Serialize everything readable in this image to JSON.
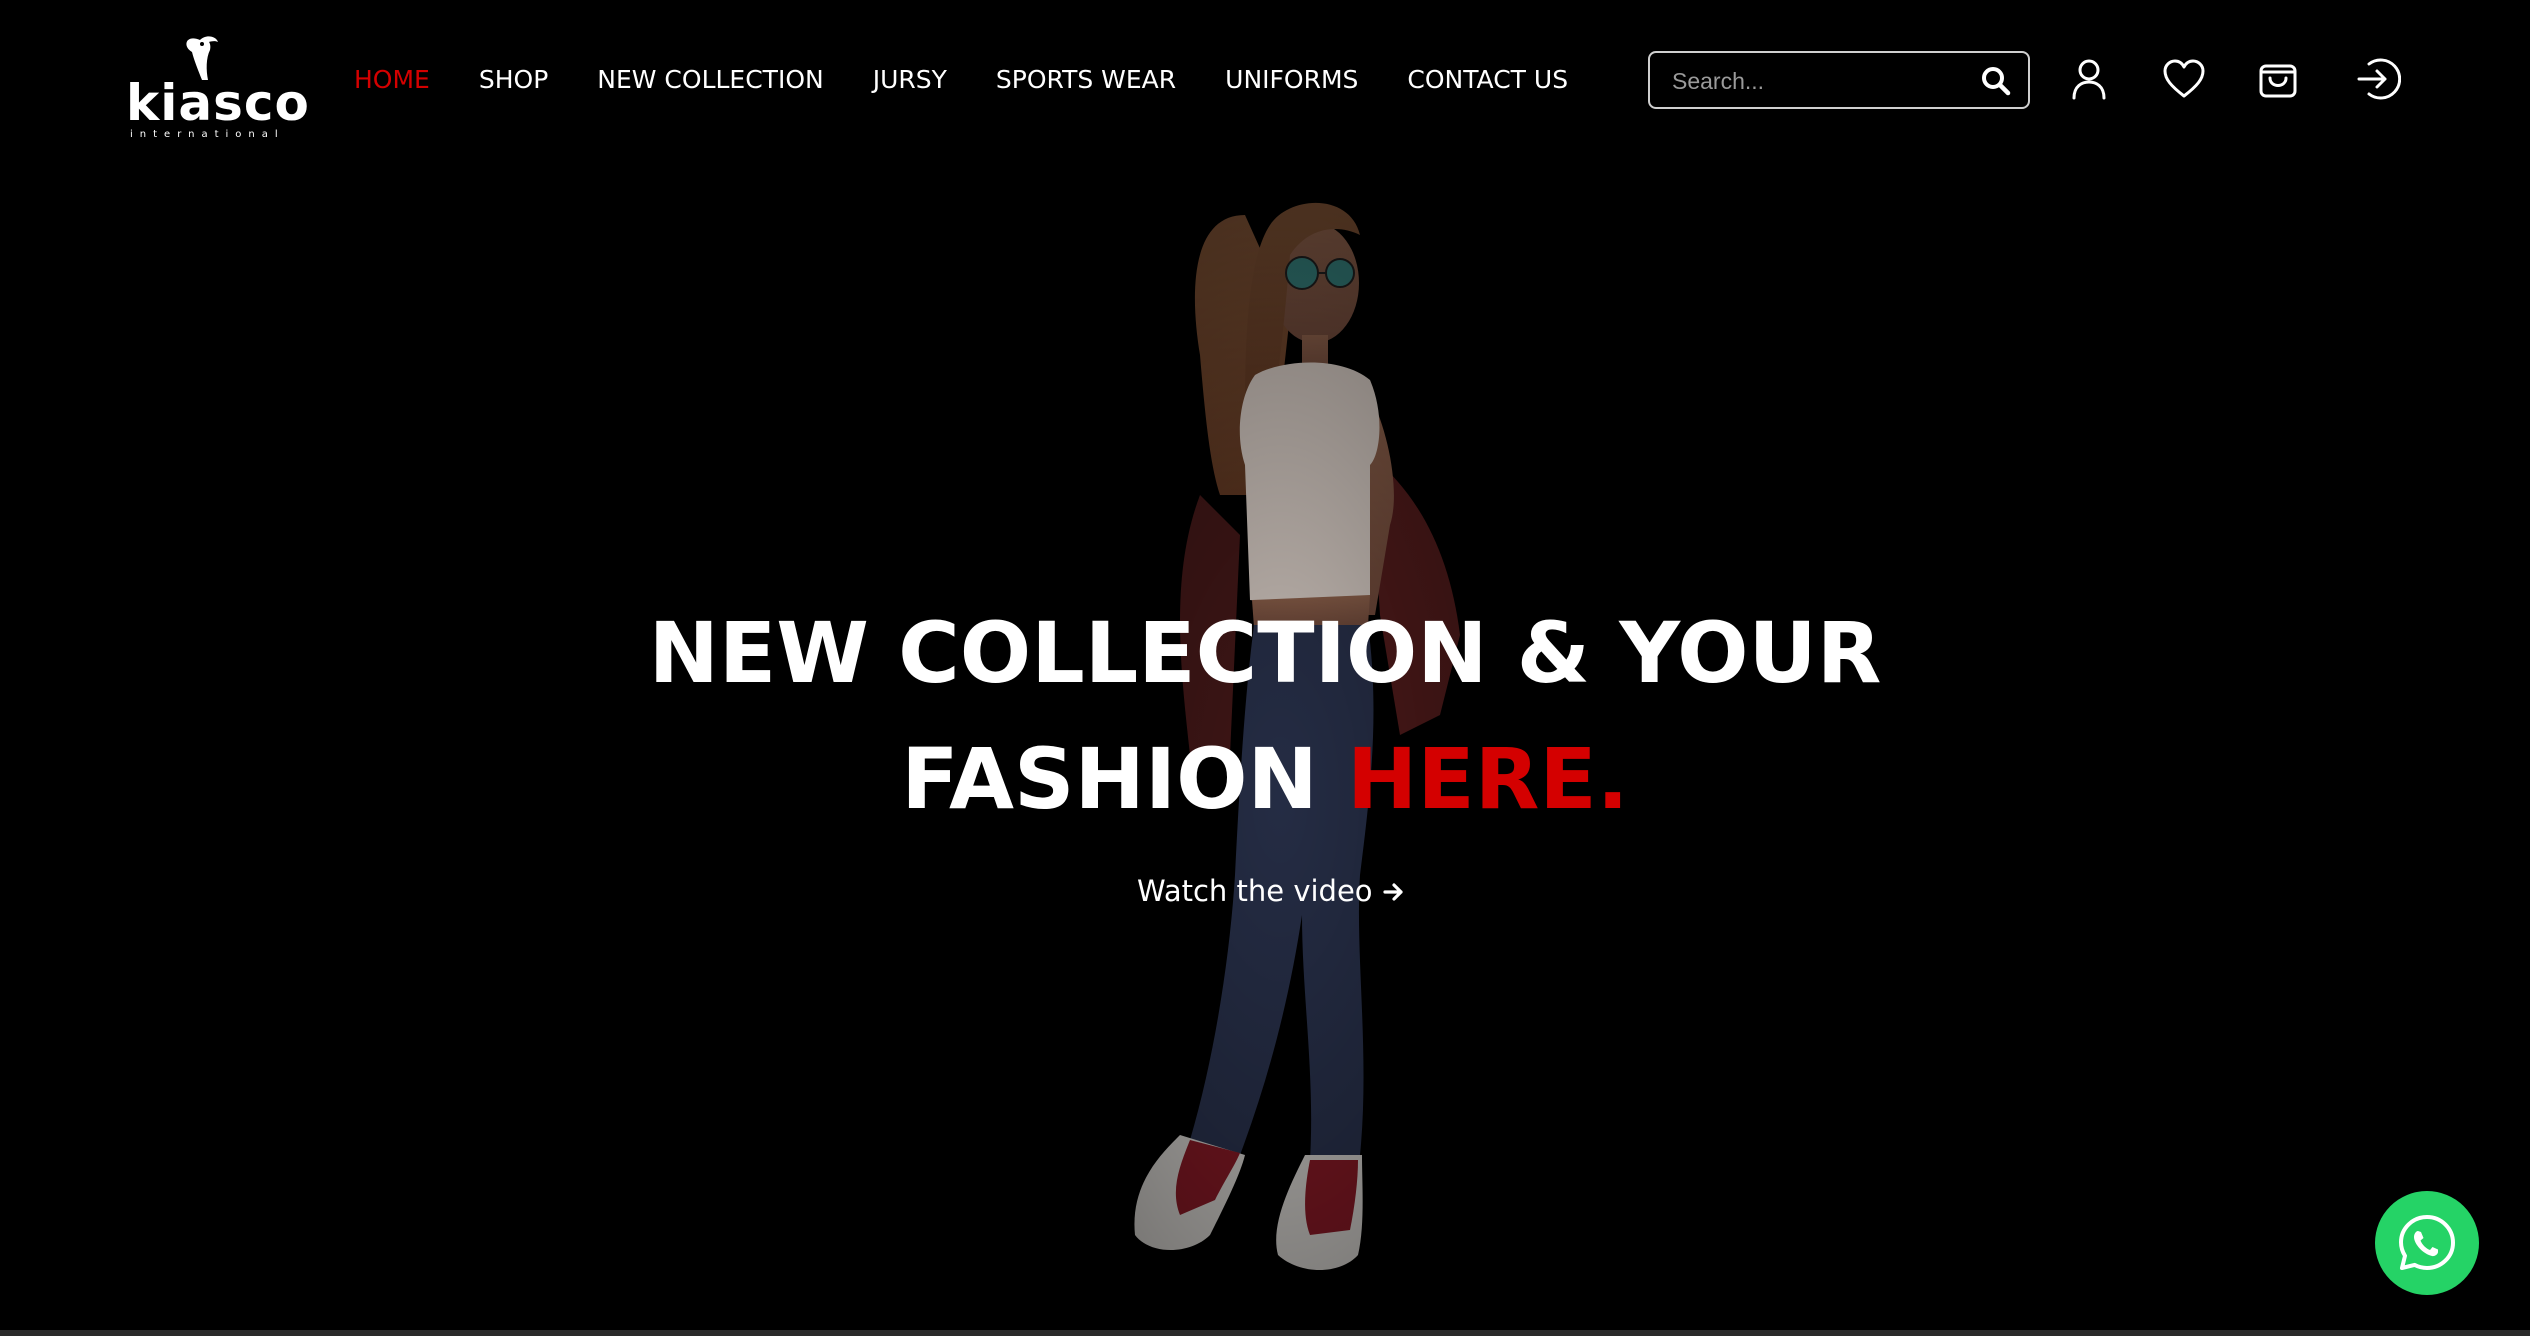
{
  "logo": {
    "name": "kiasco",
    "tagline": "international"
  },
  "nav": {
    "items": [
      {
        "label": "HOME",
        "active": true
      },
      {
        "label": "SHOP",
        "active": false
      },
      {
        "label": "NEW COLLECTION",
        "active": false
      },
      {
        "label": "JURSY",
        "active": false
      },
      {
        "label": "SPORTS WEAR",
        "active": false
      },
      {
        "label": "UNIFORMS",
        "active": false
      },
      {
        "label": "CONTACT US",
        "active": false
      }
    ]
  },
  "search": {
    "placeholder": "Search...",
    "value": "",
    "icon": "search-icon"
  },
  "header_icons": [
    "user-icon",
    "heart-icon",
    "shopping-bag-icon",
    "login-icon"
  ],
  "hero": {
    "title_line1": "NEW COLLECTION & YOUR",
    "title_line2_a": "FASHION ",
    "title_line2_b": "HERE.",
    "cta": "Watch the video",
    "cta_icon": "arrow-right-icon"
  },
  "floating": {
    "icon": "whatsapp-icon"
  },
  "colors": {
    "background": "#000000",
    "accent": "#d40000",
    "whatsapp": "#25d366"
  }
}
